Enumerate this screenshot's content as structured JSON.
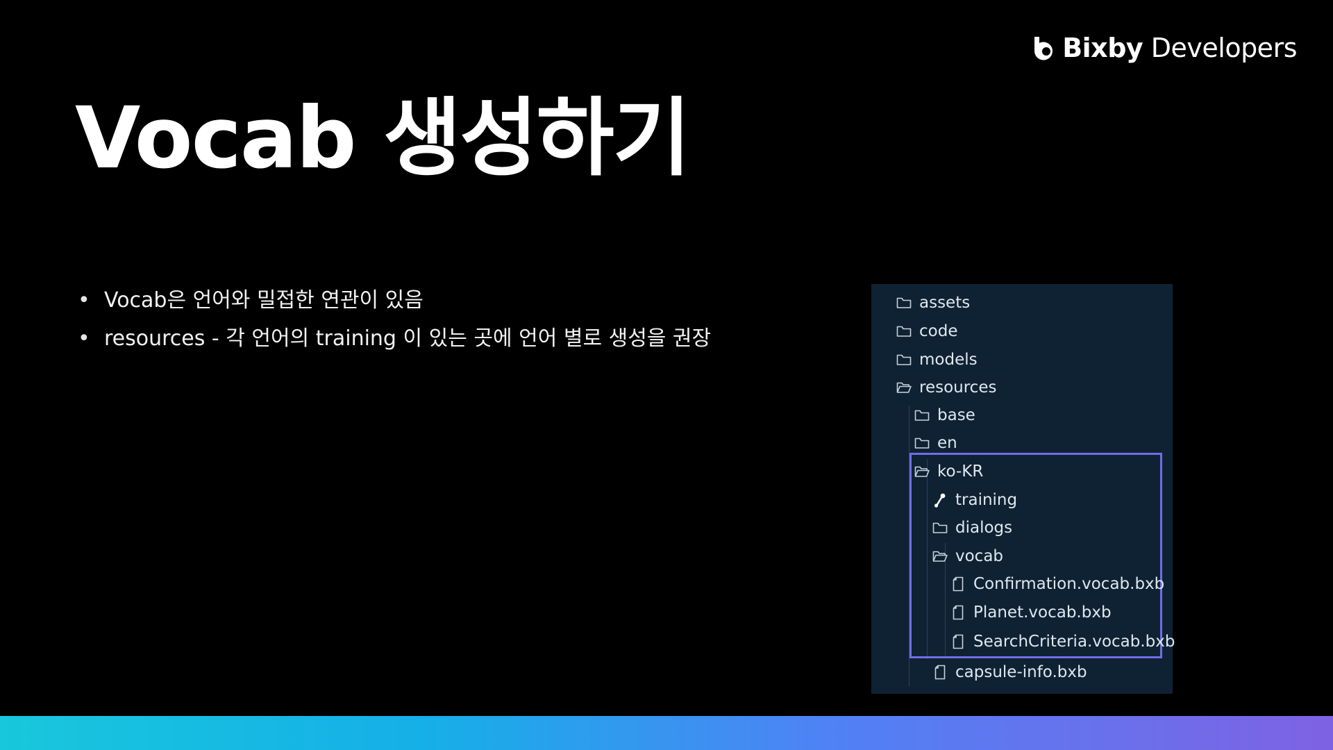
{
  "brand": {
    "name_bold": "Bixby",
    "name_regular": " Developers"
  },
  "slide": {
    "title": "Vocab 생성하기",
    "bullets": [
      "Vocab은 언어와 밀접한 연관이 있음",
      "resources - 각 언어의 training 이 있는 곳에 언어 별로 생성을 권장"
    ]
  },
  "file_tree": {
    "items": [
      {
        "label": "assets",
        "icon": "folder-icon"
      },
      {
        "label": "code",
        "icon": "folder-icon"
      },
      {
        "label": "models",
        "icon": "folder-icon"
      },
      {
        "label": "resources",
        "icon": "folder-open-icon"
      },
      {
        "label": "base",
        "icon": "folder-icon"
      },
      {
        "label": "en",
        "icon": "folder-icon"
      },
      {
        "label": "ko-KR",
        "icon": "folder-open-icon"
      },
      {
        "label": "training",
        "icon": "training-icon"
      },
      {
        "label": "dialogs",
        "icon": "folder-icon"
      },
      {
        "label": "vocab",
        "icon": "folder-open-icon"
      },
      {
        "label": "Confirmation.vocab.bxb",
        "icon": "file-icon"
      },
      {
        "label": "Planet.vocab.bxb",
        "icon": "file-icon"
      },
      {
        "label": "SearchCriteria.vocab.bxb",
        "icon": "file-icon"
      },
      {
        "label": "capsule-info.bxb",
        "icon": "file-icon"
      }
    ]
  },
  "colors": {
    "background": "#000000",
    "panel": "#0f2233",
    "highlight_border": "#6f6ee8",
    "bar_gradient": [
      "#18c7dc",
      "#4f82f5",
      "#7e62e4"
    ]
  }
}
